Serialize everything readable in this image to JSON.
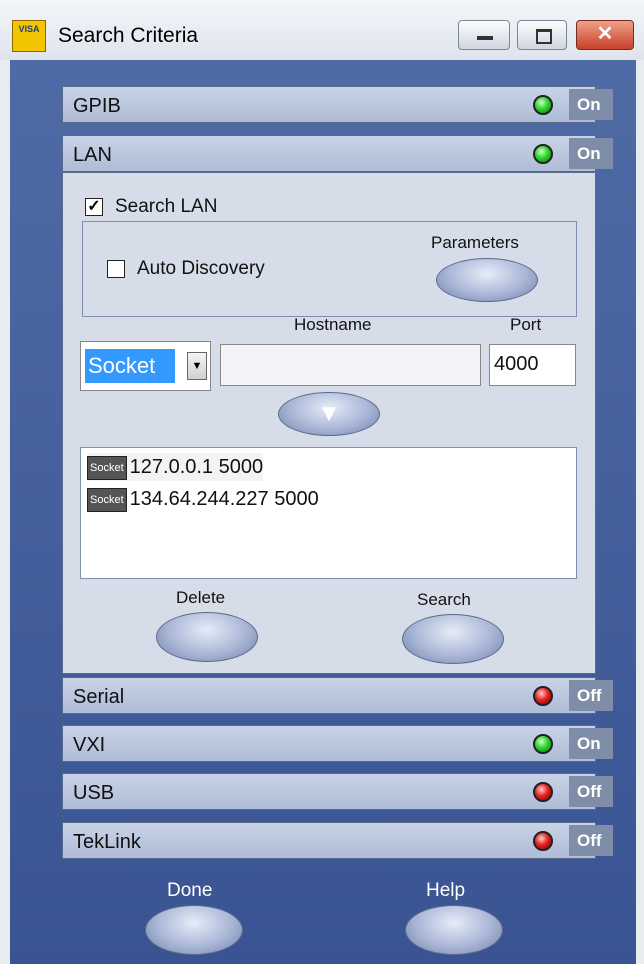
{
  "window": {
    "title": "Search Criteria",
    "icon_label": "VISA",
    "close_glyph": "✕"
  },
  "sections": [
    {
      "label": "GPIB",
      "led": "green",
      "state": "On"
    },
    {
      "label": "LAN",
      "led": "green",
      "state": "On"
    },
    {
      "label": "Serial",
      "led": "red",
      "state": "Off"
    },
    {
      "label": "VXI",
      "led": "green",
      "state": "On"
    },
    {
      "label": "USB",
      "led": "red",
      "state": "Off"
    },
    {
      "label": "TekLink",
      "led": "red",
      "state": "Off"
    }
  ],
  "lan": {
    "search_lan_label": "Search LAN",
    "search_lan_checked": true,
    "auto_discovery_label": "Auto Discovery",
    "auto_discovery_checked": false,
    "parameters_label": "Parameters",
    "protocol_value": "Socket",
    "hostname_label": "Hostname",
    "hostname_value": "",
    "port_label": "Port",
    "port_value": "4000",
    "add_glyph": "▼",
    "list": [
      {
        "tag": "Socket",
        "text": "127.0.0.1 5000"
      },
      {
        "tag": "Socket",
        "text": "134.64.244.227 5000"
      }
    ],
    "delete_label": "Delete",
    "search_label": "Search"
  },
  "footer": {
    "done_label": "Done",
    "help_label": "Help"
  },
  "colors": {
    "background": "#3f5a98",
    "led_green": "#2fd42f",
    "led_red": "#e82020",
    "selection": "#3399ff"
  }
}
